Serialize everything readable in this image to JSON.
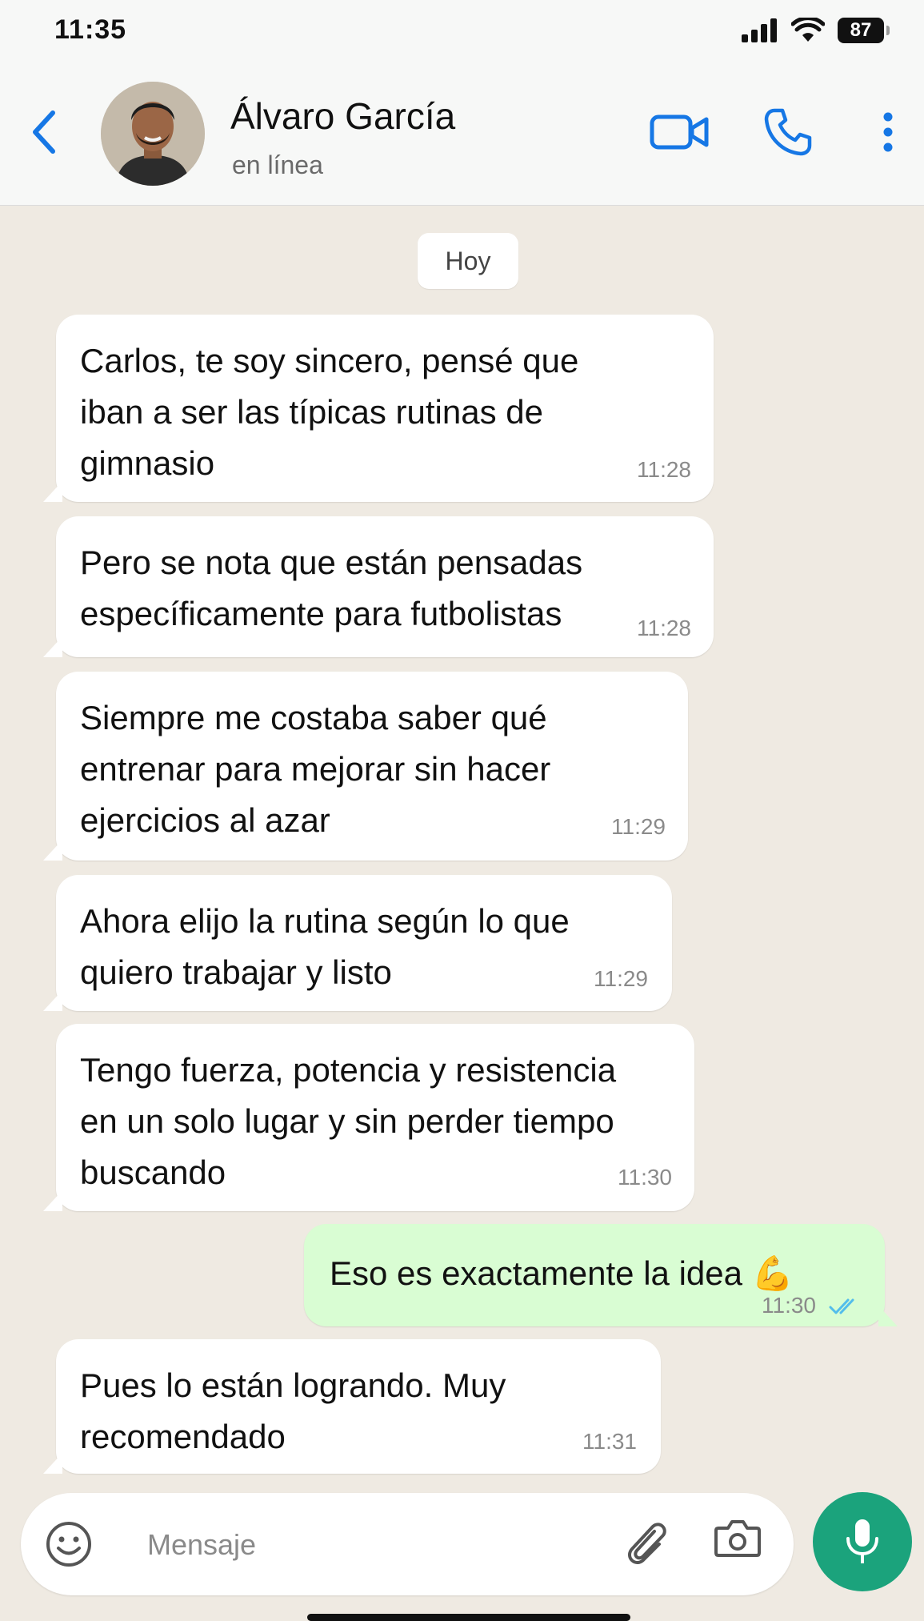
{
  "status_bar": {
    "time": "11:35",
    "battery": "87"
  },
  "header": {
    "contact_name": "Álvaro García",
    "contact_status": "en línea",
    "icons": [
      "chevron-left-icon",
      "video-call-icon",
      "phone-icon",
      "more-vertical-icon"
    ]
  },
  "chat": {
    "date_label": "Hoy",
    "messages": [
      {
        "direction": "in",
        "text": "Carlos, te soy sincero, pensé que\niban a ser las típicas rutinas de\ngimnasio",
        "time": "11:28"
      },
      {
        "direction": "in",
        "text": "Pero se nota que están pensadas\nespecíficamente para futbolistas",
        "time": "11:28"
      },
      {
        "direction": "in",
        "text": "Siempre me costaba saber qué\nentrenar para mejorar sin hacer\nejercicios al azar",
        "time": "11:29"
      },
      {
        "direction": "in",
        "text": "Ahora elijo la rutina según lo que\nquiero trabajar y listo",
        "time": "11:29"
      },
      {
        "direction": "in",
        "text": "Tengo fuerza, potencia y resistencia\nen un solo lugar y sin perder tiempo\nbuscando",
        "time": "11:30"
      },
      {
        "direction": "out",
        "text": "Eso es exactamente la idea 💪",
        "time": "11:30",
        "status": "read"
      },
      {
        "direction": "in",
        "text": "Pues lo están logrando. Muy\nrecomendado",
        "time": "11:31"
      }
    ]
  },
  "composer": {
    "placeholder": "Mensaje",
    "value": "",
    "icons": [
      "emoji-icon",
      "paperclip-icon",
      "camera-icon",
      "microphone-icon"
    ]
  },
  "colors": {
    "accent_blue": "#1677e5",
    "chat_background": "#efeae2",
    "incoming_bubble": "#ffffff",
    "outgoing_bubble": "#d9fdd3",
    "mic_button": "#1ba37c",
    "read_check": "#53bdeb"
  }
}
